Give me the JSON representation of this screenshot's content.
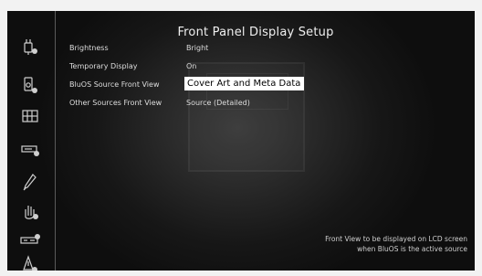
{
  "screen": {
    "title": "Front Panel Display Setup"
  },
  "settings": [
    {
      "label": "Brightness",
      "value": "Bright"
    },
    {
      "label": "Temporary Display",
      "value": "On"
    },
    {
      "label": "BluOS Source Front View",
      "value": "Cover Art and Meta Data",
      "selected": true
    },
    {
      "label": "Other Sources Front View",
      "value": "Source (Detailed)"
    }
  ],
  "help": {
    "line1": "Front View to be displayed on LCD screen",
    "line2": "when BluOS is the active source"
  },
  "sidebar": {
    "icons": [
      "plug-settings-icon",
      "speaker-settings-icon",
      "grid-settings-icon",
      "device-settings-icon",
      "pen-icon",
      "hand-settings-icon",
      "amplifier-settings-icon",
      "power-settings-icon"
    ]
  },
  "colors": {
    "highlight": "#ffffff",
    "text": "#e6e6e6",
    "background": "#1a1a1a"
  }
}
